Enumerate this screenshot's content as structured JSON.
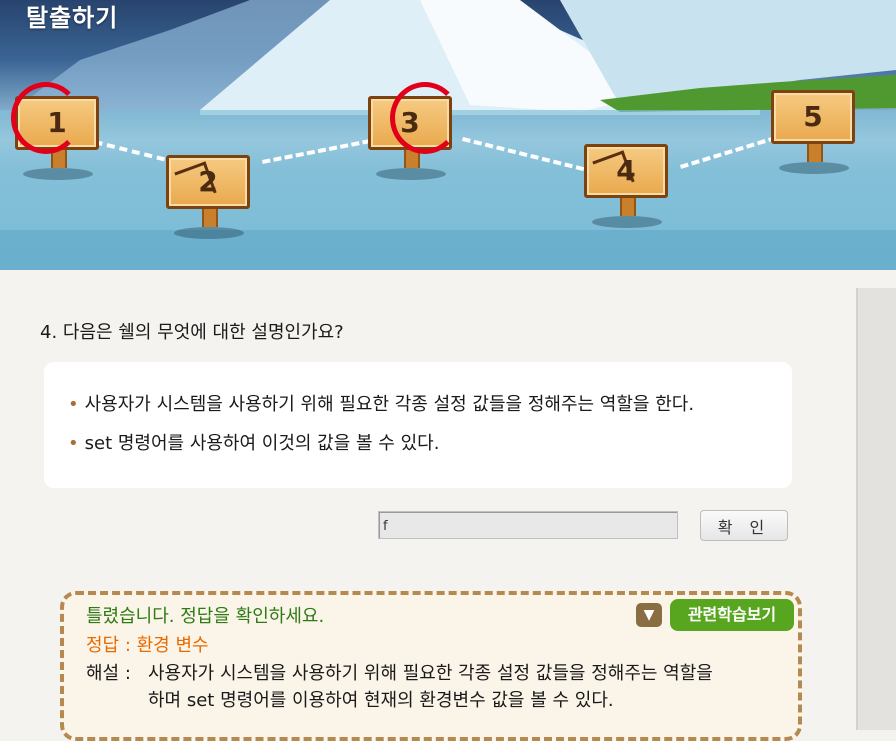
{
  "banner": {
    "title": "탈출하기",
    "boards": [
      {
        "number": "1",
        "status": "correct"
      },
      {
        "number": "2",
        "status": "cracked"
      },
      {
        "number": "3",
        "status": "correct"
      },
      {
        "number": "4",
        "status": "cracked"
      },
      {
        "number": "5",
        "status": "pending"
      }
    ]
  },
  "quiz": {
    "question": "4. 다음은 쉘의 무엇에 대한 설명인가요?",
    "bullet": "•",
    "info_items": [
      "사용자가 시스템을 사용하기 위해 필요한 각종 설정 값들을 정해주는 역할을 한다.",
      "set 명령어를 사용하여 이것의 값을 볼 수 있다."
    ],
    "answer_value": "f",
    "confirm_label": "확 인"
  },
  "result": {
    "message": "틀렸습니다.  정답을 확인하세요.",
    "answer_line": "정답 : 환경 변수",
    "explanation_label": "해설 :",
    "explanation_line1": "사용자가 시스템을 사용하기 위해 필요한 각종 설정 값들을 정해주는 역할을",
    "explanation_line2": "하며 set 명령어를 이용하여 현재의 환경변수 값을 볼 수 있다.",
    "toggle_icon": "▼",
    "related_label": "관련학습보기"
  },
  "colors": {
    "result_message": "#2e7a15",
    "answer_text": "#ea6a00",
    "related_button": "#58a51f",
    "correct_mark": "#e1001a"
  }
}
